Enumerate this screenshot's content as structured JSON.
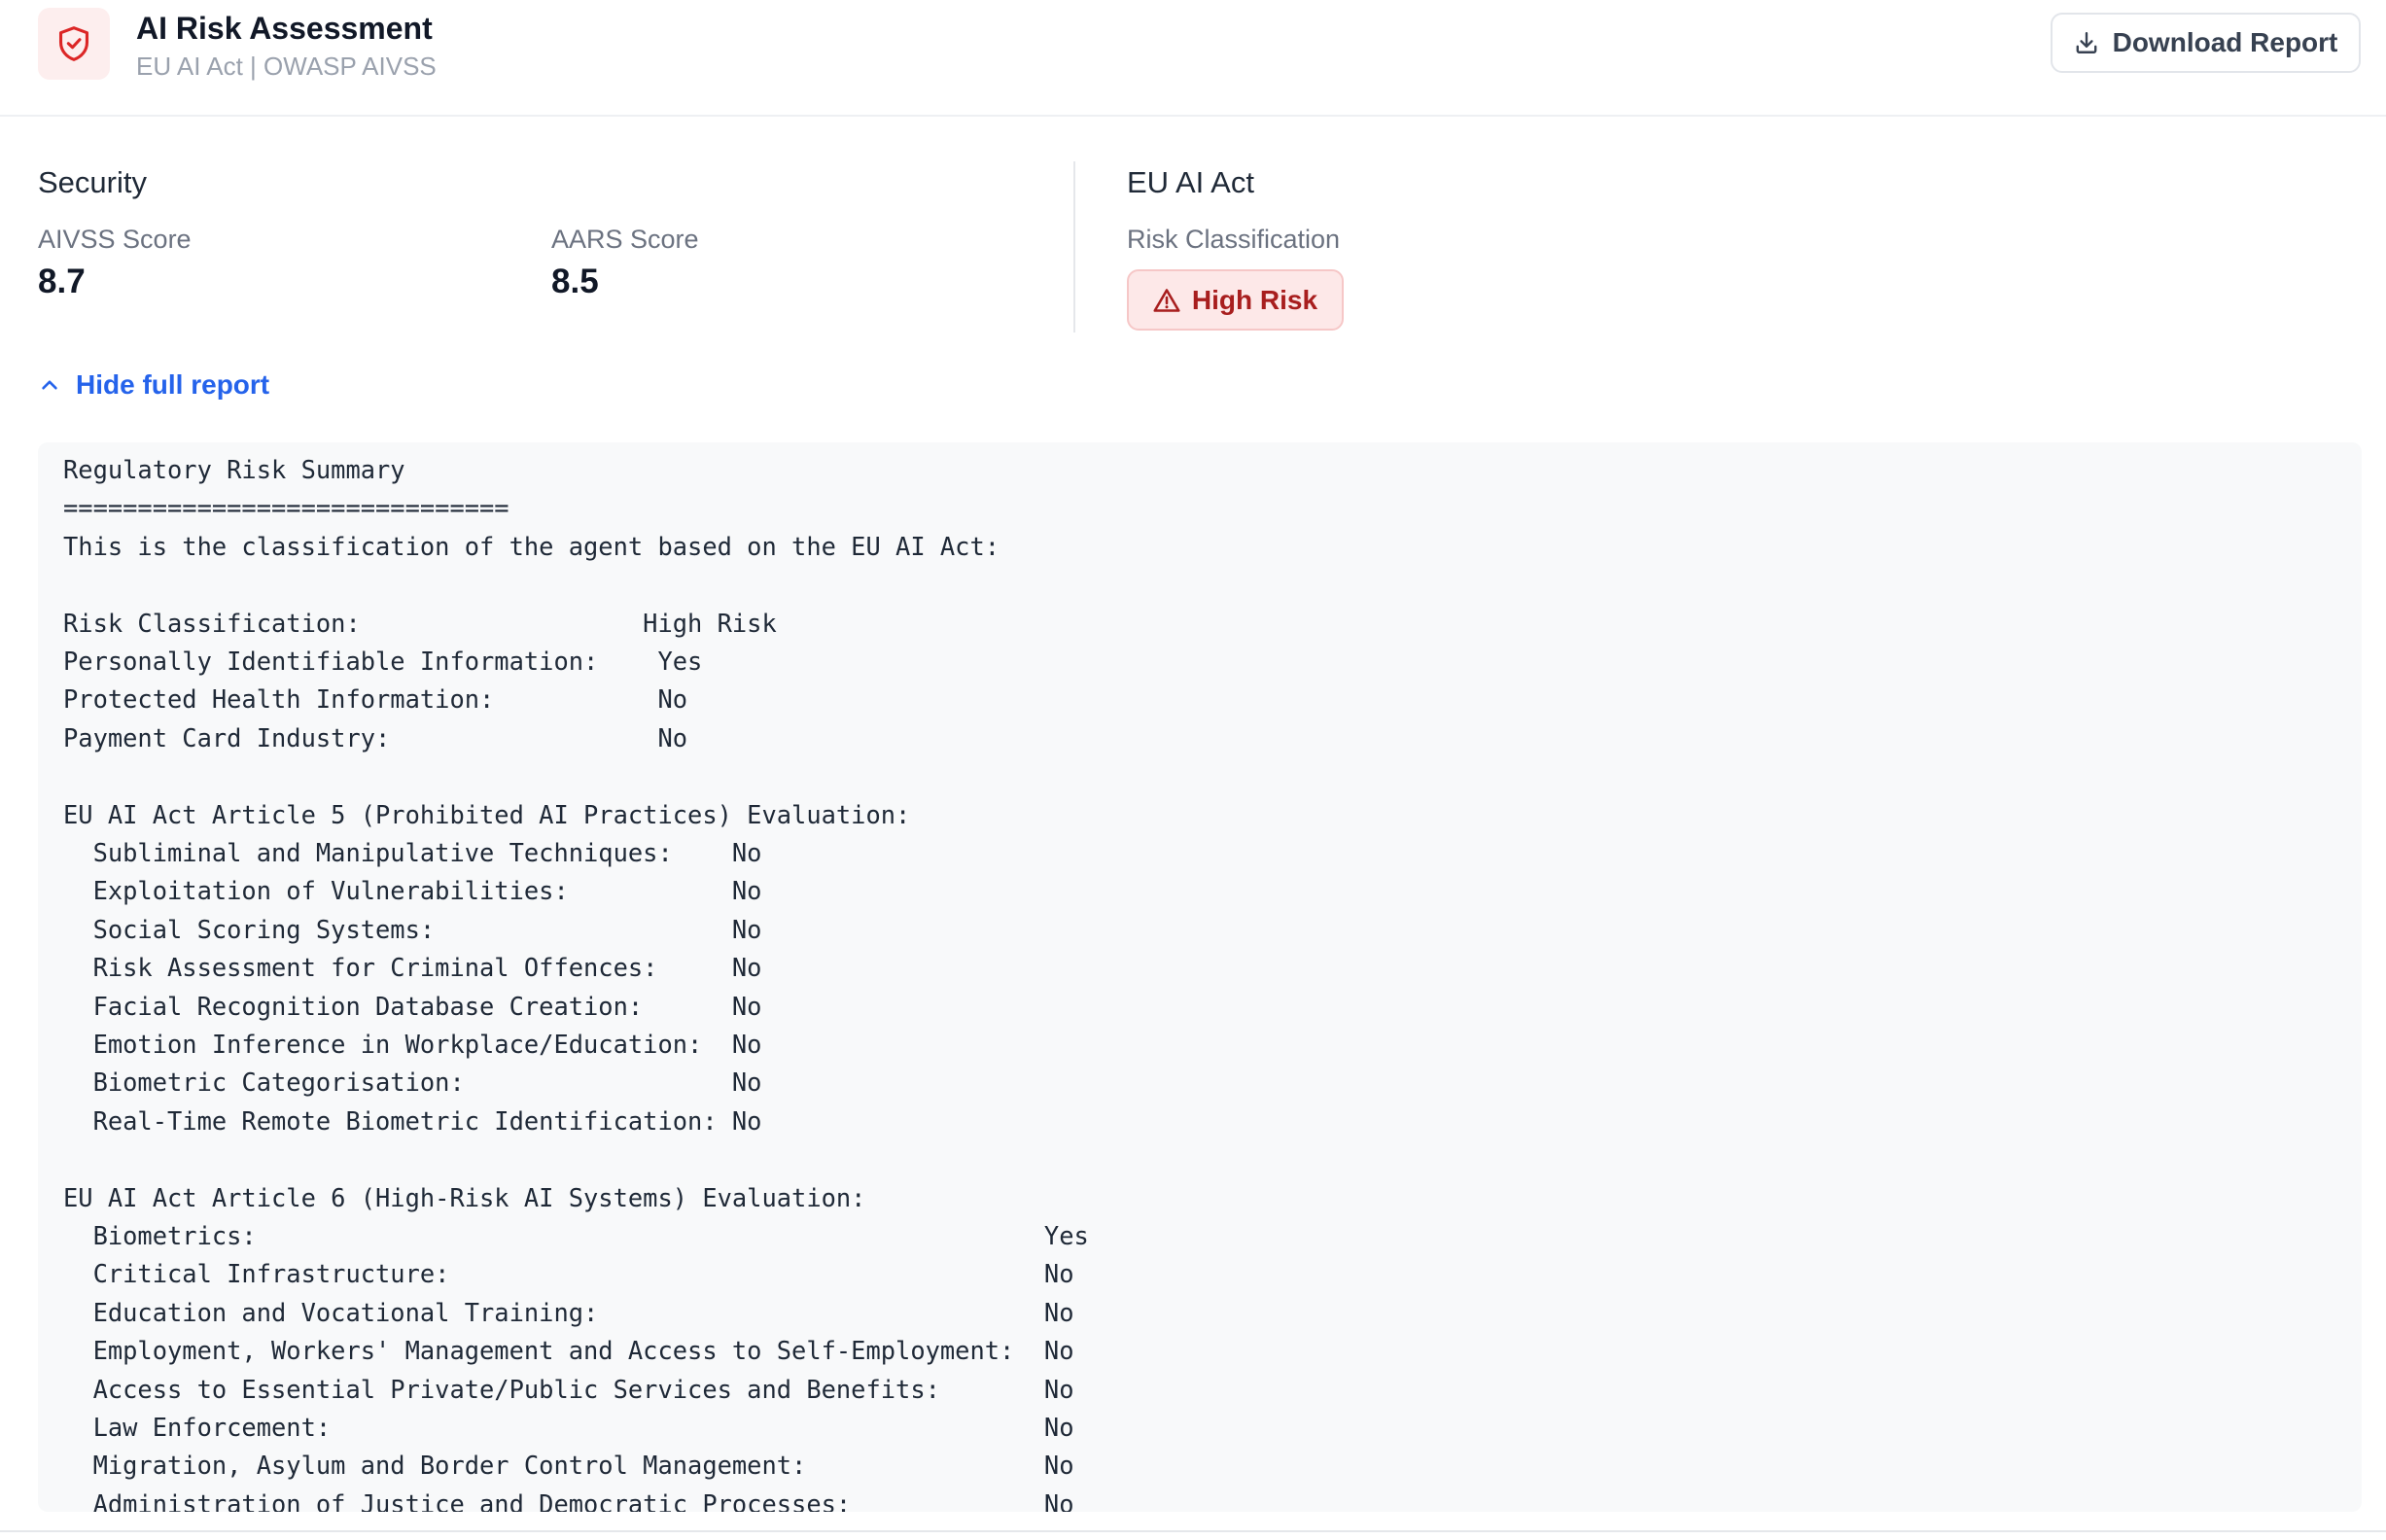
{
  "header": {
    "title": "AI Risk Assessment",
    "subtitle": "EU AI Act | OWASP AIVSS",
    "download_label": "Download Report"
  },
  "security": {
    "title": "Security",
    "aivss_label": "AIVSS Score",
    "aivss_value": "8.7",
    "aars_label": "AARS Score",
    "aars_value": "8.5"
  },
  "eu_ai_act": {
    "title": "EU AI Act",
    "risk_label": "Risk Classification",
    "risk_value": "High Risk"
  },
  "toggle": {
    "label": "Hide full report"
  },
  "report": {
    "lines": [
      "Regulatory Risk Summary",
      "==============================",
      "This is the classification of the agent based on the EU AI Act:",
      "",
      "Risk Classification:                   High Risk",
      "Personally Identifiable Information:    Yes",
      "Protected Health Information:           No",
      "Payment Card Industry:                  No",
      "",
      "EU AI Act Article 5 (Prohibited AI Practices) Evaluation:",
      "  Subliminal and Manipulative Techniques:    No",
      "  Exploitation of Vulnerabilities:           No",
      "  Social Scoring Systems:                    No",
      "  Risk Assessment for Criminal Offences:     No",
      "  Facial Recognition Database Creation:      No",
      "  Emotion Inference in Workplace/Education:  No",
      "  Biometric Categorisation:                  No",
      "  Real-Time Remote Biometric Identification: No",
      "",
      "EU AI Act Article 6 (High-Risk AI Systems) Evaluation:",
      "  Biometrics:                                                     Yes",
      "  Critical Infrastructure:                                        No",
      "  Education and Vocational Training:                              No",
      "  Employment, Workers' Management and Access to Self-Employment:  No",
      "  Access to Essential Private/Public Services and Benefits:       No",
      "  Law Enforcement:                                                No",
      "  Migration, Asylum and Border Control Management:                No",
      "  Administration of Justice and Democratic Processes:             No"
    ]
  },
  "colors": {
    "accent_blue": "#2563eb",
    "risk_red": "#a81e1e",
    "risk_bg": "#fde8e8",
    "shield_red": "#dc2626"
  },
  "icons": {
    "app": "shield-check-icon",
    "download": "download-icon",
    "risk": "warning-triangle-icon",
    "toggle": "chevron-up-icon"
  }
}
